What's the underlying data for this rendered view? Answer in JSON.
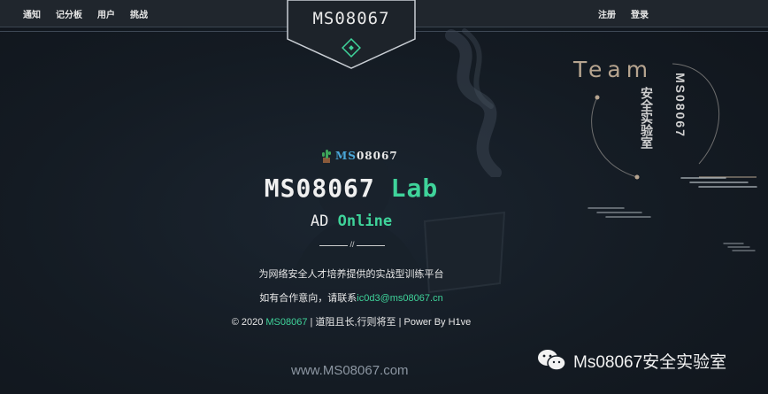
{
  "nav": {
    "left": [
      "通知",
      "记分板",
      "用户",
      "挑战"
    ],
    "right": [
      "注册",
      "登录"
    ]
  },
  "logo": {
    "text": "MS08067"
  },
  "team": {
    "word": "Team",
    "cn": "安全实验室",
    "en": "MS08067"
  },
  "sub_logo": {
    "ms": "MS",
    "rest": "08067"
  },
  "title": {
    "main": "MS08067",
    "accent": "Lab"
  },
  "subtitle": {
    "main": "AD",
    "accent": "Online"
  },
  "divider": {
    "mark": "//"
  },
  "tagline": "为网络安全人才培养提供的实战型训练平台",
  "contact": {
    "prefix": "如有合作意向，请联系",
    "email": "ic0d3@ms08067.cn"
  },
  "footer": {
    "prefix": "© 2020",
    "brand": "MS08067",
    "suffix": "| 道阻且长,行则将至 | Power By H1ve"
  },
  "url": "www.MS08067.com",
  "watermark": "Ms08067安全实验室",
  "colors": {
    "accent": "#3fd39a",
    "background": "#141b23",
    "topbar": "#20262d"
  }
}
